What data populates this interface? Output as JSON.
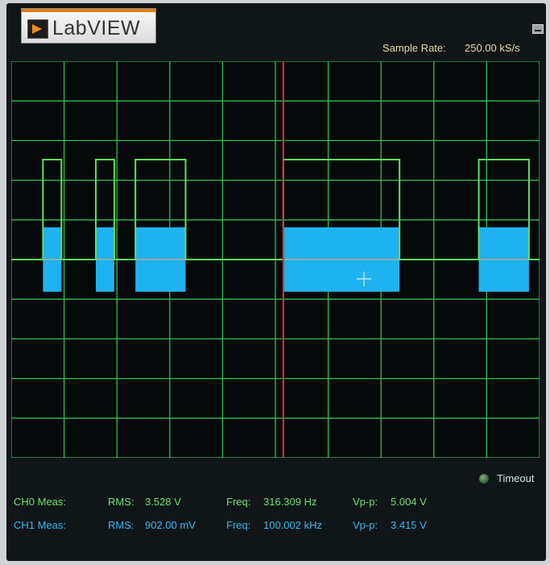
{
  "app": {
    "logo_text": "LabVIEW"
  },
  "header": {
    "sample_rate_label": "Sample Rate:",
    "sample_rate_value": "250.00 kS/s"
  },
  "status": {
    "timeout_label": "Timeout"
  },
  "measurements": [
    {
      "channel_label": "CH0 Meas:",
      "rms_label": "RMS:",
      "rms_value": "3.528 V",
      "freq_label": "Freq:",
      "freq_value": "316.309 Hz",
      "vpp_label": "Vp-p:",
      "vpp_value": "5.004 V"
    },
    {
      "channel_label": "CH1 Meas:",
      "rms_label": "RMS:",
      "rms_value": "902.00 mV",
      "freq_label": "Freq:",
      "freq_value": "100.002 kHz",
      "vpp_label": "Vp-p:",
      "vpp_value": "3.415 V"
    }
  ],
  "colors": {
    "background": "#101518",
    "grid": "#2fbf4f",
    "ch0_trace": "#5fe05f",
    "ch1_trace": "#1fb2f0",
    "cursor": "#e23030",
    "baseline": "#8ea7b0"
  },
  "chart_data": {
    "type": "line",
    "grid": true,
    "divisions": {
      "x": 10,
      "y": 10
    },
    "series": [
      {
        "channel": "CH0",
        "shape": "pulse-train",
        "low": 0,
        "high": 5.0,
        "pulses": [
          [
            0.6,
            0.95
          ],
          [
            1.6,
            1.95
          ],
          [
            2.35,
            3.3
          ],
          [
            5.15,
            7.35
          ],
          [
            8.85,
            9.8
          ]
        ]
      },
      {
        "channel": "CH1",
        "shape": "burst",
        "center": 0,
        "amplitude": 1.7,
        "bursts": [
          [
            0.6,
            0.95
          ],
          [
            1.6,
            1.95
          ],
          [
            2.35,
            3.3
          ],
          [
            5.15,
            7.35
          ],
          [
            8.85,
            9.8
          ]
        ]
      }
    ],
    "cursor_x": 5.15
  }
}
